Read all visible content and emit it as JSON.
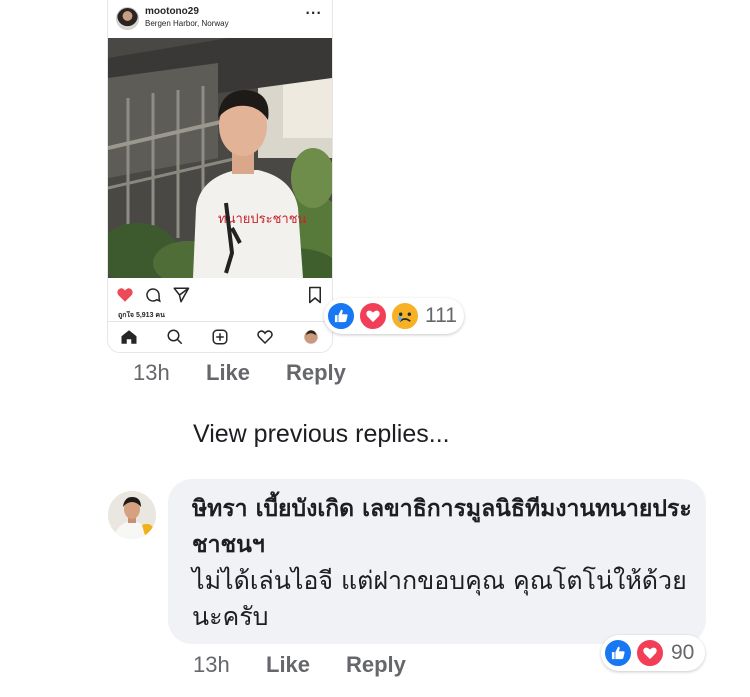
{
  "shared_post": {
    "username": "mootono29",
    "location": "Bergen Harbor, Norway",
    "more_icon": "more-dots-icon",
    "shirt_text": "ทนายประชาชน",
    "likes_text": "ถูกใจ 5,913 คน",
    "action_icons": [
      "heart-filled-icon",
      "comment-icon",
      "share-icon",
      "bookmark-icon"
    ],
    "tab_icons": [
      "home-icon",
      "search-icon",
      "add-post-icon",
      "activity-heart-icon",
      "profile-avatar-icon"
    ]
  },
  "top_comment": {
    "reactions": [
      "like",
      "love",
      "sad"
    ],
    "reaction_count": "111",
    "time": "13h",
    "like_label": "Like",
    "reply_label": "Reply"
  },
  "view_previous": "View previous replies...",
  "reply": {
    "author": "ษิทรา เบี้ยบังเกิด เลขาธิการมูลนิธิทีมงานทนายประชาชนฯ",
    "text": "ไม่ได้เล่นไอจี แต่ฝากขอบคุณ คุณโตโน่ให้ด้วยนะครับ",
    "reactions": [
      "like",
      "love"
    ],
    "reaction_count": "90",
    "time": "13h",
    "like_label": "Like",
    "reply_label": "Reply"
  },
  "colors": {
    "like_blue": "#1877f2",
    "love_red": "#f33e58",
    "sad_yellow": "#f7b125",
    "bubble_bg": "#f0f2f5",
    "meta_gray": "#65676b",
    "ig_heart": "#ed4956"
  }
}
